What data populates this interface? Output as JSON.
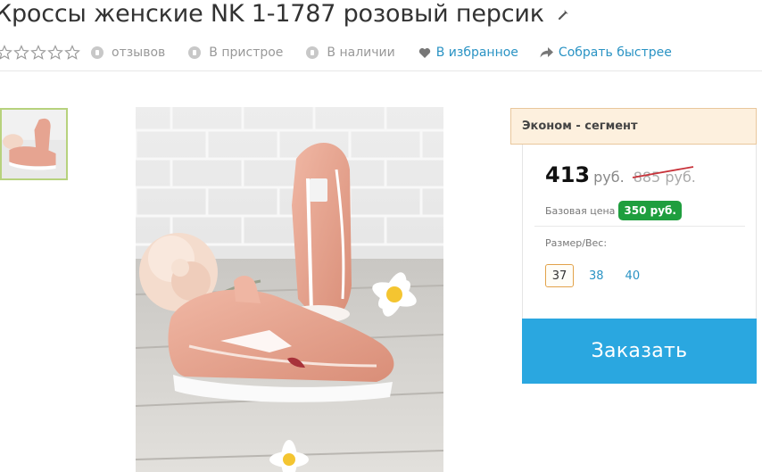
{
  "product": {
    "title": "Кроссы женские NK 1-1787 розовый персик"
  },
  "meta": {
    "rating": 0,
    "reviews_label": "отзывов",
    "attach_label": "В пристрое",
    "stock_label": "В наличии",
    "wishlist_label": "В избранное",
    "quick_buy_label": "Собрать быстрее"
  },
  "offer": {
    "segment": "Эконом - сегмент",
    "price": "413",
    "currency": "руб.",
    "old_price": "885 руб.",
    "base_label": "Базовая цена",
    "base_price": "350 руб.",
    "size_label": "Размер/Вес:",
    "sizes": [
      "37",
      "38",
      "40"
    ],
    "selected_size": "37",
    "order_label": "Заказать"
  },
  "colors": {
    "accent": "#2aa7e0",
    "link": "#2a93c4",
    "badge": "#1f9e3e",
    "segment_bg": "#fdf0de",
    "strike": "#c8323a"
  }
}
